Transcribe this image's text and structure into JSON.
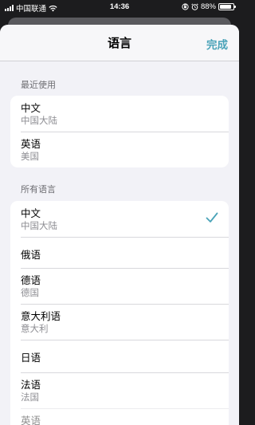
{
  "status_bar": {
    "carrier": "中国联通",
    "time": "14:36",
    "battery": "88%",
    "battery_level": 0.88
  },
  "nav": {
    "title": "语言",
    "done_label": "完成"
  },
  "recent": {
    "header": "最近使用",
    "items": [
      {
        "name": "中文",
        "region": "中国大陆"
      },
      {
        "name": "英语",
        "region": "美国"
      }
    ]
  },
  "all": {
    "header": "所有语言",
    "items": [
      {
        "name": "中文",
        "region": "中国大陆",
        "selected": true
      },
      {
        "name": "俄语"
      },
      {
        "name": "德语",
        "region": "德国"
      },
      {
        "name": "意大利语",
        "region": "意大利"
      },
      {
        "name": "日语"
      },
      {
        "name": "法语",
        "region": "法国"
      },
      {
        "name": "英语"
      }
    ]
  },
  "colors": {
    "accent": "#4aa3b8",
    "background": "#f2f2f7"
  },
  "icons": {
    "wifi": "wifi-icon",
    "lock_rotation": "orientation-lock-icon",
    "alarm": "alarm-icon",
    "check": "checkmark-icon"
  }
}
